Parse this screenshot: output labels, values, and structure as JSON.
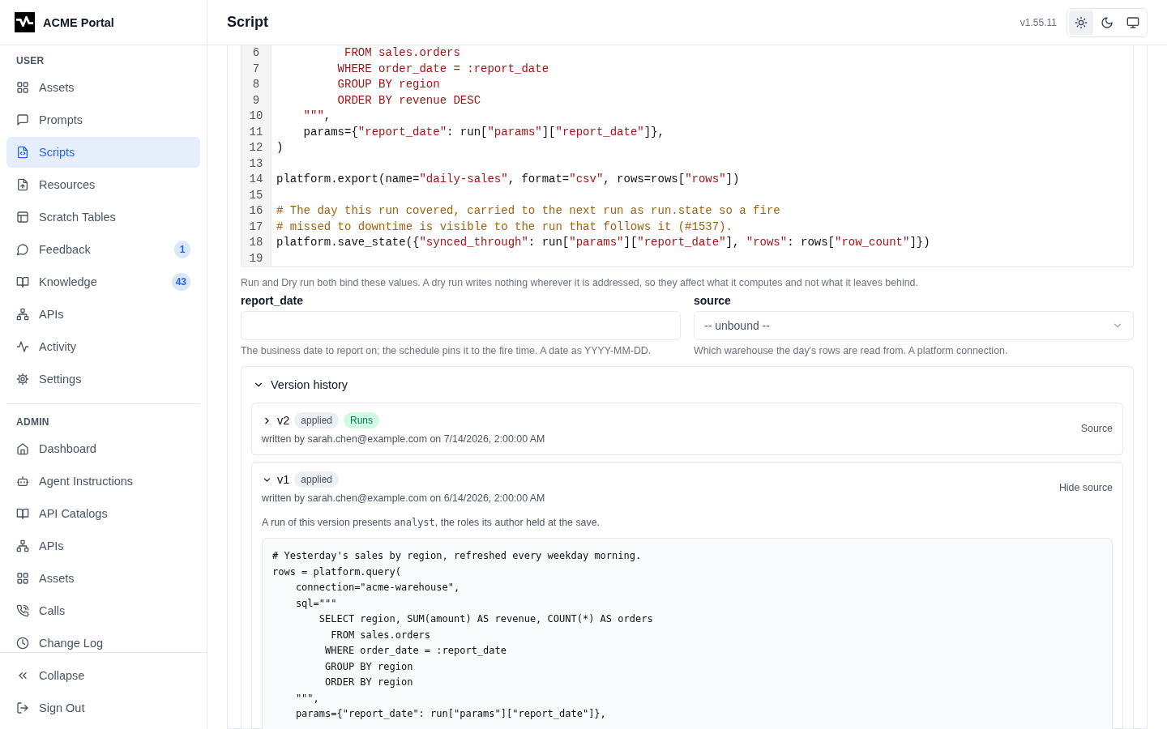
{
  "sidebar": {
    "brand": "ACME Portal",
    "sections": [
      {
        "title": "USER",
        "items": [
          {
            "label": "Assets",
            "selected": false
          },
          {
            "label": "Prompts",
            "selected": false
          },
          {
            "label": "Scripts",
            "selected": true
          },
          {
            "label": "Resources",
            "selected": false
          },
          {
            "label": "Scratch Tables",
            "selected": false
          },
          {
            "label": "Feedback",
            "selected": false,
            "badge": "1"
          },
          {
            "label": "Knowledge",
            "selected": false,
            "badge": "43"
          },
          {
            "label": "APIs",
            "selected": false
          },
          {
            "label": "Activity",
            "selected": false
          },
          {
            "label": "Settings",
            "selected": false
          }
        ]
      },
      {
        "title": "ADMIN",
        "items": [
          {
            "label": "Dashboard",
            "selected": false
          },
          {
            "label": "Agent Instructions",
            "selected": false
          },
          {
            "label": "API Catalogs",
            "selected": false
          },
          {
            "label": "APIs",
            "selected": false
          },
          {
            "label": "Assets",
            "selected": false
          },
          {
            "label": "Calls",
            "selected": false
          },
          {
            "label": "Change Log",
            "selected": false
          }
        ]
      }
    ],
    "footer": [
      {
        "label": "Collapse"
      },
      {
        "label": "Sign Out"
      }
    ]
  },
  "header": {
    "title": "Script",
    "version": "v1.55.11",
    "theme_toggle": [
      {
        "selected": true
      },
      {
        "selected": false
      },
      {
        "selected": false
      }
    ]
  },
  "editor": {
    "lines": [
      {
        "number": "6",
        "tokens": [
          {
            "kind": "str",
            "text": "          FROM sales.orders"
          }
        ]
      },
      {
        "number": "7",
        "tokens": [
          {
            "kind": "str",
            "text": "         WHERE order_date = :report_date"
          }
        ]
      },
      {
        "number": "8",
        "tokens": [
          {
            "kind": "str",
            "text": "         GROUP BY region"
          }
        ]
      },
      {
        "number": "9",
        "tokens": [
          {
            "kind": "str",
            "text": "         ORDER BY revenue DESC"
          }
        ]
      },
      {
        "number": "10",
        "tokens": [
          {
            "kind": "str",
            "text": "    \"\"\""
          },
          {
            "kind": "plain",
            "text": ","
          }
        ]
      },
      {
        "number": "11",
        "tokens": [
          {
            "kind": "plain",
            "text": "    params={"
          },
          {
            "kind": "str",
            "text": "\"report_date\""
          },
          {
            "kind": "plain",
            "text": ": run["
          },
          {
            "kind": "str",
            "text": "\"params\""
          },
          {
            "kind": "plain",
            "text": "]["
          },
          {
            "kind": "str",
            "text": "\"report_date\""
          },
          {
            "kind": "plain",
            "text": "]},"
          }
        ]
      },
      {
        "number": "12",
        "tokens": [
          {
            "kind": "plain",
            "text": ")"
          }
        ]
      },
      {
        "number": "13"
      },
      {
        "number": "14",
        "tokens": [
          {
            "kind": "plain",
            "text": "platform.export(name="
          },
          {
            "kind": "str",
            "text": "\"daily-sales\""
          },
          {
            "kind": "plain",
            "text": ", format="
          },
          {
            "kind": "str",
            "text": "\"csv\""
          },
          {
            "kind": "plain",
            "text": ", rows=rows["
          },
          {
            "kind": "str",
            "text": "\"rows\""
          },
          {
            "kind": "plain",
            "text": "])"
          }
        ]
      },
      {
        "number": "15"
      },
      {
        "number": "16",
        "tokens": [
          {
            "kind": "comment",
            "text": "# The day this run covered, carried to the next run as run.state so a fire"
          }
        ]
      },
      {
        "number": "17",
        "tokens": [
          {
            "kind": "comment",
            "text": "# missed to downtime is visible to the run that follows it (#1537)."
          }
        ]
      },
      {
        "number": "18",
        "tokens": [
          {
            "kind": "plain",
            "text": "platform.save_state({"
          },
          {
            "kind": "str",
            "text": "\"synced_through\""
          },
          {
            "kind": "plain",
            "text": ": run["
          },
          {
            "kind": "str",
            "text": "\"params\""
          },
          {
            "kind": "plain",
            "text": "]["
          },
          {
            "kind": "str",
            "text": "\"report_date\""
          },
          {
            "kind": "plain",
            "text": "], "
          },
          {
            "kind": "str",
            "text": "\"rows\""
          },
          {
            "kind": "plain",
            "text": ": rows["
          },
          {
            "kind": "str",
            "text": "\"row_count\""
          },
          {
            "kind": "plain",
            "text": "]})"
          }
        ]
      },
      {
        "number": "19"
      }
    ]
  },
  "params_note": "Run and Dry run both bind these values. A dry run writes nothing wherever it is addressed, so they affect what it computes and not what it leaves behind.",
  "params": [
    {
      "kind": "text",
      "label": "report_date",
      "help": "The business date to report on; the schedule pins it to the fire time. A date as YYYY-MM-DD."
    },
    {
      "kind": "select",
      "label": "source",
      "value": "-- unbound --",
      "help": "Which warehouse the day's rows are read from. A platform connection."
    }
  ],
  "version_history": {
    "title": "Version history",
    "expanded": true,
    "versions": [
      {
        "name": "v2",
        "expanded": false,
        "badges": [
          {
            "label": "applied",
            "kind": "neutral"
          },
          {
            "label": "Runs",
            "kind": "success"
          }
        ],
        "meta": "written by sarah.chen@example.com on 7/14/2026, 2:00:00 AM",
        "source_toggle": "Source"
      },
      {
        "name": "v1",
        "expanded": true,
        "badges": [
          {
            "label": "applied",
            "kind": "neutral"
          }
        ],
        "meta": "written by sarah.chen@example.com on 6/14/2026, 2:00:00 AM",
        "source_toggle": "Hide source",
        "note": {
          "before": "A run of this version presents ",
          "code": "analyst",
          "after": ", the roles its author held at the save."
        },
        "source": [
          "# Yesterday's sales by region, refreshed every weekday morning.",
          "rows = platform.query(",
          "    connection=\"acme-warehouse\",",
          "    sql=\"\"\"",
          "        SELECT region, SUM(amount) AS revenue, COUNT(*) AS orders",
          "          FROM sales.orders",
          "         WHERE order_date = :report_date",
          "         GROUP BY region",
          "         ORDER BY region",
          "    \"\"\",",
          "    params={\"report_date\": run[\"params\"][\"report_date\"]},"
        ]
      }
    ]
  }
}
